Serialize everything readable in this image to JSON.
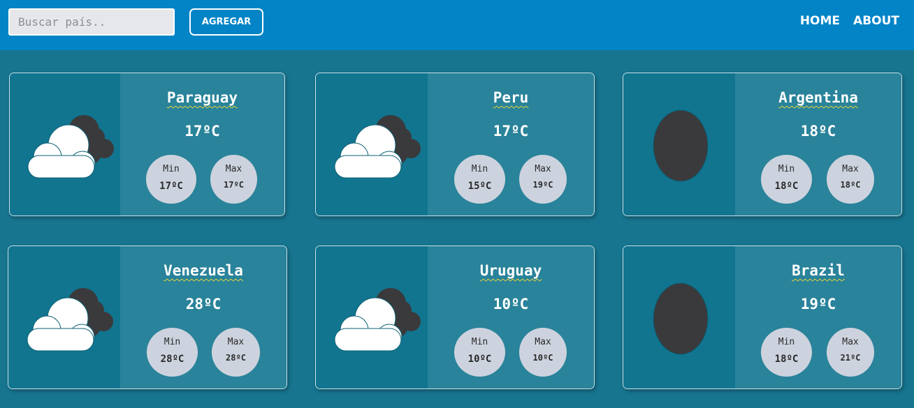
{
  "search": {
    "placeholder": "Buscar país..",
    "value": ""
  },
  "toolbar": {
    "add_label": "AGREGAR"
  },
  "nav": {
    "home": "HOME",
    "about": "ABOUT"
  },
  "labels": {
    "min": "Min",
    "max": "Max"
  },
  "colors": {
    "topbar": "#0284c7",
    "background": "#17758f",
    "card_icon_panel": "#117590",
    "card_info_panel": "#29839a",
    "minmax_circle": "#cdd3de"
  },
  "cards": [
    {
      "country": "Paraguay",
      "temp": "17ºC",
      "min": "17ºC",
      "max": "17ºC",
      "icon": "cloudy-icon"
    },
    {
      "country": "Peru",
      "temp": "17ºC",
      "min": "15ºC",
      "max": "19ºC",
      "icon": "cloudy-icon"
    },
    {
      "country": "Argentina",
      "temp": "18ºC",
      "min": "18ºC",
      "max": "18ºC",
      "icon": "dark-circle-icon"
    },
    {
      "country": "Venezuela",
      "temp": "28ºC",
      "min": "28ºC",
      "max": "28ºC",
      "icon": "cloudy-icon"
    },
    {
      "country": "Uruguay",
      "temp": "10ºC",
      "min": "10ºC",
      "max": "10ºC",
      "icon": "cloudy-icon"
    },
    {
      "country": "Brazil",
      "temp": "19ºC",
      "min": "18ºC",
      "max": "21ºC",
      "icon": "dark-circle-icon"
    }
  ]
}
